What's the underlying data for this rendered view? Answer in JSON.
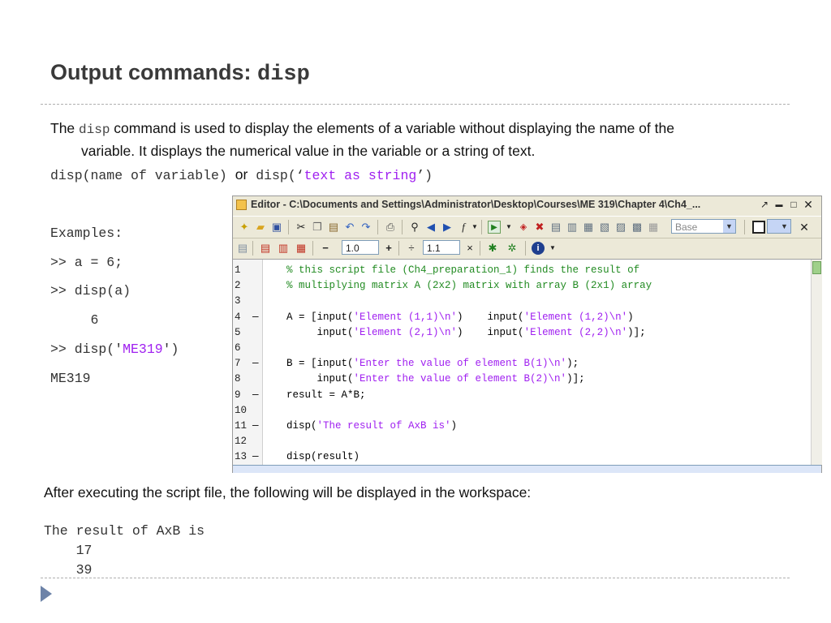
{
  "slide": {
    "title_text": "Output commands: ",
    "title_code": "disp",
    "intro_prefix": "The ",
    "intro_code": "disp",
    "intro_line1": " command is used to display the elements of a variable without displaying the name of the",
    "intro_line2": "variable. It displays the numerical value in the variable or a string of text.",
    "syntax_a": "disp(name of variable) ",
    "syntax_or": "or",
    "syntax_b_pre": " disp(‘",
    "syntax_b_str": "text as string",
    "syntax_b_post": "’)",
    "examples": {
      "heading": "Examples:",
      "line1": ">> a = 6;",
      "line2": ">> disp(a)",
      "line3": "     6",
      "line4_pre": ">> disp('",
      "line4_str": "ME319",
      "line4_post": "')",
      "line5": "ME319"
    },
    "after_text": "After executing the script file, the following will be displayed in the workspace:",
    "output": [
      "The result of AxB is",
      "    17",
      "    39"
    ]
  },
  "editor": {
    "title": "Editor - C:\\Documents and Settings\\Administrator\\Desktop\\Courses\\ME 319\\Chapter 4\\Ch4_...",
    "base_label": "Base",
    "step1_value": "1.0",
    "step2_value": "1.1",
    "plus": "+",
    "divide": "÷",
    "minus": "−",
    "times": "×",
    "lines": [
      {
        "n": "1",
        "m": "",
        "c": "% this script file (Ch4_preparation_1) finds the result of"
      },
      {
        "n": "2",
        "m": "",
        "c": "% multiplying matrix A (2x2) matrix with array B (2x1) array"
      },
      {
        "n": "3",
        "m": "",
        "c": ""
      },
      {
        "n": "4",
        "m": "—",
        "a": "A = [input(",
        "s1": "'Element (1,1)\\n'",
        "b": ")    input(",
        "s2": "'Element (1,2)\\n'",
        "e": ")"
      },
      {
        "n": "5",
        "m": "",
        "a": "     input(",
        "s1": "'Element (2,1)\\n'",
        "b": ")    input(",
        "s2": "'Element (2,2)\\n'",
        "e": ")];"
      },
      {
        "n": "6",
        "m": "",
        "c": ""
      },
      {
        "n": "7",
        "m": "—",
        "a": "B = [input(",
        "s1": "'Enter the value of element B(1)\\n'",
        "e": ");"
      },
      {
        "n": "8",
        "m": "",
        "a": "     input(",
        "s1": "'Enter the value of element B(2)\\n'",
        "e": ")];"
      },
      {
        "n": "9",
        "m": "—",
        "a": "result = A*B;"
      },
      {
        "n": "10",
        "m": "",
        "c": ""
      },
      {
        "n": "11",
        "m": "—",
        "a": "disp(",
        "s1": "'The result of AxB is'",
        "e": ")"
      },
      {
        "n": "12",
        "m": "",
        "c": ""
      },
      {
        "n": "13",
        "m": "—",
        "a": "disp(result)"
      }
    ]
  }
}
